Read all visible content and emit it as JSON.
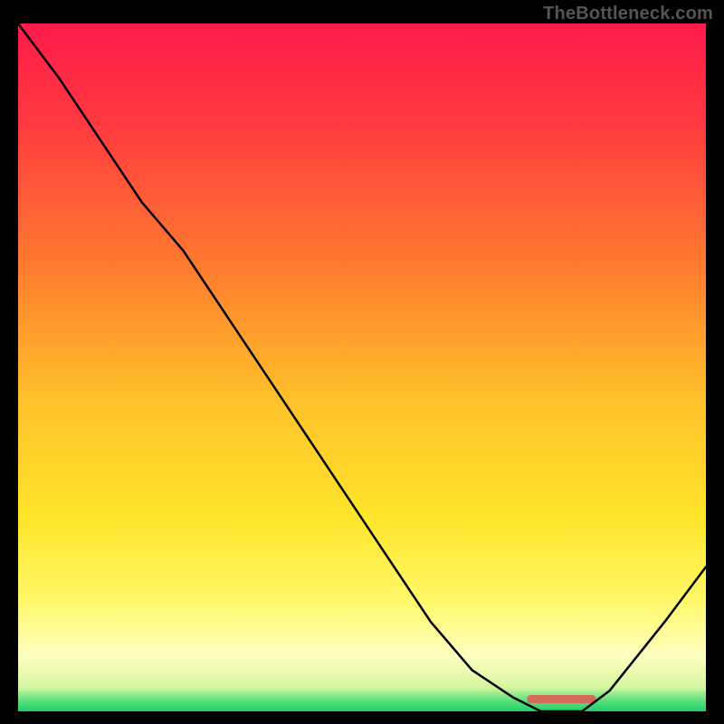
{
  "watermark": "TheBottleneck.com",
  "chart_data": {
    "type": "line",
    "x": [
      0.0,
      0.06,
      0.12,
      0.18,
      0.24,
      0.3,
      0.36,
      0.42,
      0.48,
      0.54,
      0.6,
      0.66,
      0.72,
      0.76,
      0.8,
      0.82,
      0.86,
      0.9,
      0.94,
      1.0
    ],
    "values": [
      1.0,
      0.92,
      0.83,
      0.74,
      0.67,
      0.58,
      0.49,
      0.4,
      0.31,
      0.22,
      0.13,
      0.06,
      0.02,
      0.0,
      0.0,
      0.0,
      0.03,
      0.08,
      0.13,
      0.21
    ],
    "title": "",
    "xlabel": "",
    "ylabel": "",
    "xlim": [
      0,
      1
    ],
    "ylim": [
      0,
      1
    ],
    "background": {
      "type": "vertical-gradient",
      "stops": [
        {
          "pos": 0.0,
          "color": "#ff1a4b"
        },
        {
          "pos": 0.15,
          "color": "#ff3b3f"
        },
        {
          "pos": 0.35,
          "color": "#ff7a2e"
        },
        {
          "pos": 0.55,
          "color": "#ffc22a"
        },
        {
          "pos": 0.72,
          "color": "#ffe52a"
        },
        {
          "pos": 0.84,
          "color": "#fff86a"
        },
        {
          "pos": 0.92,
          "color": "#fdffc0"
        },
        {
          "pos": 0.965,
          "color": "#d6f6a0"
        },
        {
          "pos": 0.985,
          "color": "#57e07a"
        },
        {
          "pos": 1.0,
          "color": "#1fd06a"
        }
      ]
    },
    "optimum_band": {
      "x0": 0.74,
      "x1": 0.84,
      "color": "#d46a5a"
    }
  }
}
